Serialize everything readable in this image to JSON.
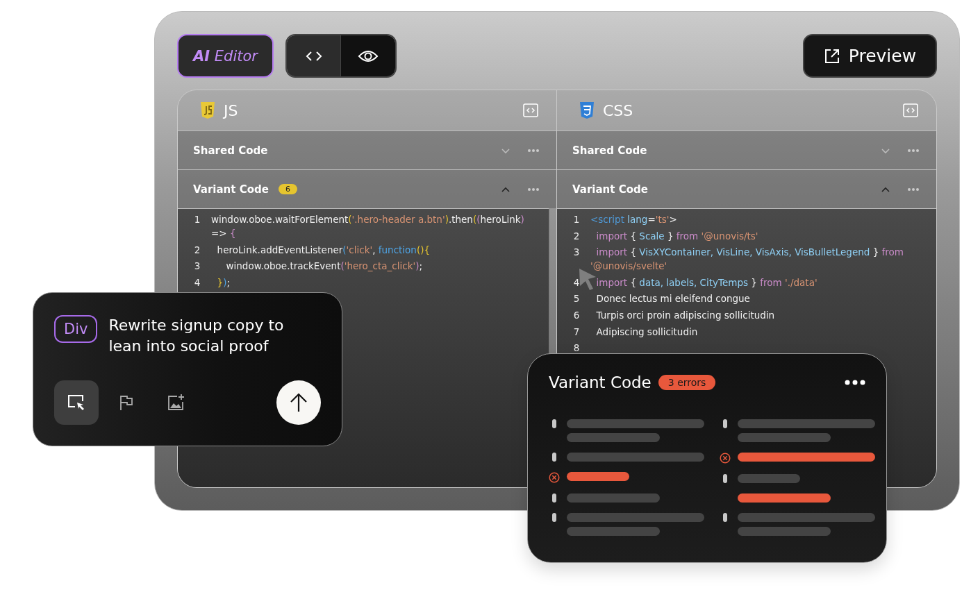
{
  "toolbar": {
    "brand": "**AI** Editor",
    "view_tabs": [
      {
        "kind": "code",
        "selected": true
      },
      {
        "kind": "preview",
        "selected": false
      }
    ],
    "preview_button": "Preview"
  },
  "panels": [
    {
      "kind": "js",
      "title": "JS",
      "sections": [
        {
          "title": "Shared Code",
          "expanded": false
        },
        {
          "title": "Variant Code",
          "expanded": true,
          "badge": "6"
        }
      ],
      "lines": [
        {
          "number": "1",
          "tokens": [
            {
              "text": "window.oboe.waitForElement",
              "kind": "text"
            },
            {
              "text": "(",
              "kind": "bracket"
            },
            {
              "text": "'.hero-header a.btn'",
              "kind": "string"
            },
            {
              "text": ")",
              "kind": "bracket"
            },
            {
              "text": ".then",
              "kind": "text"
            },
            {
              "text": "(",
              "kind": "bracket"
            },
            {
              "text": "(",
              "kind": "keyword"
            },
            {
              "text": "heroLink",
              "kind": "text"
            },
            {
              "text": ")",
              "kind": "keyword"
            },
            {
              "text": " => ",
              "kind": "text"
            },
            {
              "text": "{",
              "kind": "keyword"
            }
          ]
        },
        {
          "number": "2",
          "tokens": [
            {
              "text": "  heroLink.addEventListener",
              "kind": "text"
            },
            {
              "text": "(",
              "kind": "func"
            },
            {
              "text": "'click'",
              "kind": "string"
            },
            {
              "text": ", ",
              "kind": "text"
            },
            {
              "text": "function",
              "kind": "func"
            },
            {
              "text": "(){",
              "kind": "bracket"
            }
          ]
        },
        {
          "number": "3",
          "tokens": [
            {
              "text": "     window.oboe.trackEvent",
              "kind": "text"
            },
            {
              "text": "(",
              "kind": "keyword"
            },
            {
              "text": "'hero_cta_click'",
              "kind": "string"
            },
            {
              "text": ")",
              "kind": "keyword"
            },
            {
              "text": ";",
              "kind": "text"
            }
          ]
        },
        {
          "number": "4",
          "tokens": [
            {
              "text": "  }",
              "kind": "bracket"
            },
            {
              "text": ")",
              "kind": "func"
            },
            {
              "text": ";",
              "kind": "text"
            }
          ]
        }
      ]
    },
    {
      "kind": "css",
      "title": "CSS",
      "sections": [
        {
          "title": "Shared Code",
          "expanded": false
        },
        {
          "title": "Variant Code",
          "expanded": true
        }
      ],
      "lines": [
        {
          "number": "1",
          "tokens": [
            {
              "text": "<script",
              "kind": "tag"
            },
            {
              "text": " lang",
              "kind": "ident"
            },
            {
              "text": "=",
              "kind": "text"
            },
            {
              "text": "'ts'",
              "kind": "string"
            },
            {
              "text": ">",
              "kind": "text"
            }
          ]
        },
        {
          "number": "2",
          "tokens": [
            {
              "text": "  import",
              "kind": "keyword"
            },
            {
              "text": " { ",
              "kind": "text"
            },
            {
              "text": "Scale",
              "kind": "ident"
            },
            {
              "text": " } ",
              "kind": "text"
            },
            {
              "text": "from",
              "kind": "keyword"
            },
            {
              "text": " '@unovis/ts'",
              "kind": "string"
            }
          ]
        },
        {
          "number": "3",
          "tokens": [
            {
              "text": "  import",
              "kind": "keyword"
            },
            {
              "text": " { ",
              "kind": "text"
            },
            {
              "text": "VisXYContainer, VisLine, VisAxis, VisBulletLegend",
              "kind": "ident"
            },
            {
              "text": " } ",
              "kind": "text"
            },
            {
              "text": "from",
              "kind": "keyword"
            },
            {
              "text": " '@unovis/svelte'",
              "kind": "string"
            }
          ]
        },
        {
          "number": "4",
          "tokens": [
            {
              "text": "  import",
              "kind": "keyword"
            },
            {
              "text": " { ",
              "kind": "text"
            },
            {
              "text": "data, labels, CityTemps",
              "kind": "ident"
            },
            {
              "text": " } ",
              "kind": "text"
            },
            {
              "text": "from",
              "kind": "keyword"
            },
            {
              "text": " './data'",
              "kind": "string"
            }
          ]
        },
        {
          "number": "5",
          "tokens": [
            {
              "text": "  Donec lectus mi eleifend congue",
              "kind": "text"
            }
          ]
        },
        {
          "number": "6",
          "tokens": [
            {
              "text": "  Turpis orci proin adipiscing sollicitudin",
              "kind": "text"
            }
          ]
        },
        {
          "number": "7",
          "tokens": [
            {
              "text": "  Adipiscing sollicitudin",
              "kind": "text"
            }
          ]
        },
        {
          "number": "8"
        }
      ]
    }
  ],
  "prompt_card": {
    "tag": "Div",
    "text": "Rewrite signup copy to lean into social proof",
    "tools": [
      {
        "kind": "select",
        "selected": true
      },
      {
        "kind": "flag",
        "selected": false
      },
      {
        "kind": "image",
        "selected": false
      }
    ]
  },
  "error_card": {
    "title": "Variant Code",
    "badge": "3 errors",
    "columns": [
      [
        {
          "kind": "tick",
          "bars": [
            {
              "kind": "long",
              "error": false
            },
            {
              "kind": "short",
              "error": false
            }
          ]
        },
        {
          "kind": "tick",
          "bars": [
            {
              "kind": "long",
              "error": false
            }
          ]
        },
        {
          "kind": "error",
          "bars": [
            {
              "kind": "mid",
              "error": true
            }
          ]
        },
        {
          "kind": "tick",
          "bars": [
            {
              "kind": "short",
              "error": false
            }
          ]
        },
        {
          "kind": "tick",
          "bars": [
            {
              "kind": "long",
              "error": false
            },
            {
              "kind": "short",
              "error": false
            }
          ]
        }
      ],
      [
        {
          "kind": "tick",
          "bars": [
            {
              "kind": "long",
              "error": false
            },
            {
              "kind": "short",
              "error": false
            }
          ]
        },
        {
          "kind": "error",
          "bars": [
            {
              "kind": "long",
              "error": true
            }
          ]
        },
        {
          "kind": "tick",
          "bars": [
            {
              "kind": "mid",
              "error": false
            }
          ]
        },
        {
          "kind": "plain",
          "bars": [
            {
              "kind": "short",
              "error": true
            }
          ]
        },
        {
          "kind": "tick",
          "bars": [
            {
              "kind": "long",
              "error": false
            },
            {
              "kind": "short",
              "error": false
            }
          ]
        }
      ]
    ]
  }
}
